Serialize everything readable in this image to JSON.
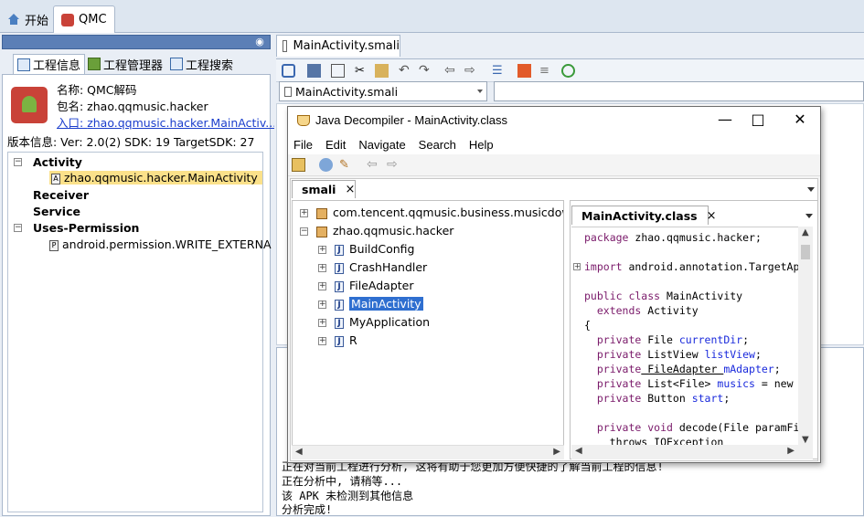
{
  "top_tabs": [
    {
      "label": "开始",
      "icon": "home-icon"
    },
    {
      "label": "QMC",
      "icon": "qmc-app-icon"
    }
  ],
  "left": {
    "tabs": [
      {
        "label": "工程信息",
        "icon": "project-info-icon"
      },
      {
        "label": "工程管理器",
        "icon": "android-icon"
      },
      {
        "label": "工程搜索",
        "icon": "search-icon"
      }
    ],
    "app_name": "名称: QMC解码",
    "package": "包名: zhao.qqmusic.hacker",
    "entry_prefix": "入口: ",
    "entry": "zhao.qqmusic.hacker.MainActiv...",
    "version": "版本信息: Ver: 2.0(2) SDK: 19 TargetSDK: 27",
    "tree": {
      "activity": "Activity",
      "activity_item": "zhao.qqmusic.hacker.MainActivity",
      "receiver": "Receiver",
      "service": "Service",
      "uses_permission": "Uses-Permission",
      "permission_item": "android.permission.WRITE_EXTERNA"
    }
  },
  "editor": {
    "file_tab": "MainActivity.smali",
    "combo_value": "MainActivity.smali"
  },
  "console": {
    "lines": [
      "正在对当前工程进行分析, 这将有助于您更加方便快捷的了解当前工程的信息!",
      "正在分析中, 请稍等...",
      "该 APK 未检测到其他信息",
      "分析完成!"
    ]
  },
  "jd": {
    "title": "Java Decompiler - MainActivity.class",
    "menu": [
      "File",
      "Edit",
      "Navigate",
      "Search",
      "Help"
    ],
    "outer_tab": "smali",
    "close_glyph": "×",
    "tree": [
      "com.tencent.qqmusic.business.musicdownlo",
      "zhao.qqmusic.hacker",
      "BuildConfig",
      "CrashHandler",
      "FileAdapter",
      "MainActivity",
      "MyApplication",
      "R"
    ],
    "class_tab": "MainActivity.class",
    "code": {
      "l1": "package zhao.qqmusic.hacker;",
      "l2": "import android.annotation.TargetAp",
      "l3_kw": "public class",
      "l3_rest": " MainActivity",
      "l4_kw": "  extends",
      "l4_rest": " Activity",
      "l5": "{",
      "l6_kw": "  private",
      "l6_rest": " File ",
      "l6_fd": "currentDir",
      "l7_kw": "  private",
      "l7_rest": " ListView ",
      "l7_fd": "listView",
      "l8_kw": "  private",
      "l8_rest": " FileAdapter ",
      "l8_fd": "mAdapter",
      "l9_kw": "  private",
      "l9_rest": " List<File> ",
      "l9_fd": "musics",
      "l9_tail": " = new",
      "l10_kw": "  private",
      "l10_rest": " Button ",
      "l10_fd": "start",
      "l11_kw": "  private void",
      "l11_rest": " decode(File paramFi",
      "l12": "    throws IOException"
    }
  }
}
